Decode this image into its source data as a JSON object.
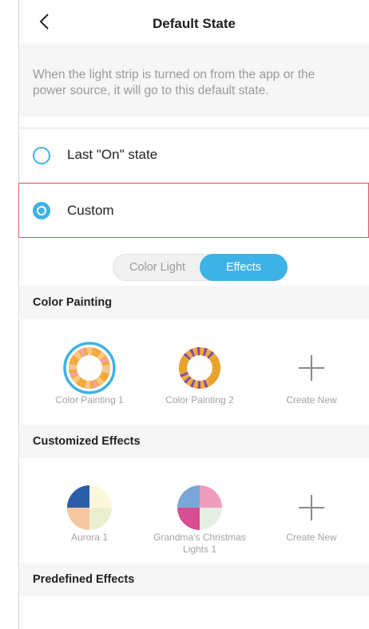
{
  "header": {
    "title": "Default State"
  },
  "description": "When the light strip is turned on from the app or the power source, it will go to this default state.",
  "options": [
    {
      "label": "Last \"On\" state",
      "checked": false
    },
    {
      "label": "Custom",
      "checked": true
    }
  ],
  "toggle": {
    "left": "Color Light",
    "right": "Effects",
    "active": "Effects"
  },
  "sections": {
    "color_painting": {
      "title": "Color Painting",
      "items": [
        "Color Painting 1",
        "Color Painting 2",
        "Create New"
      ]
    },
    "customized_effects": {
      "title": "Customized Effects",
      "items": [
        "Aurora 1",
        "Grandma's Christmas Lights 1",
        "Create New"
      ]
    },
    "predefined_effects": {
      "title": "Predefined Effects"
    }
  },
  "colors": {
    "accent": "#3db2e6",
    "highlight_border": "#e05a6b",
    "section_bg": "#f6f6f6"
  }
}
